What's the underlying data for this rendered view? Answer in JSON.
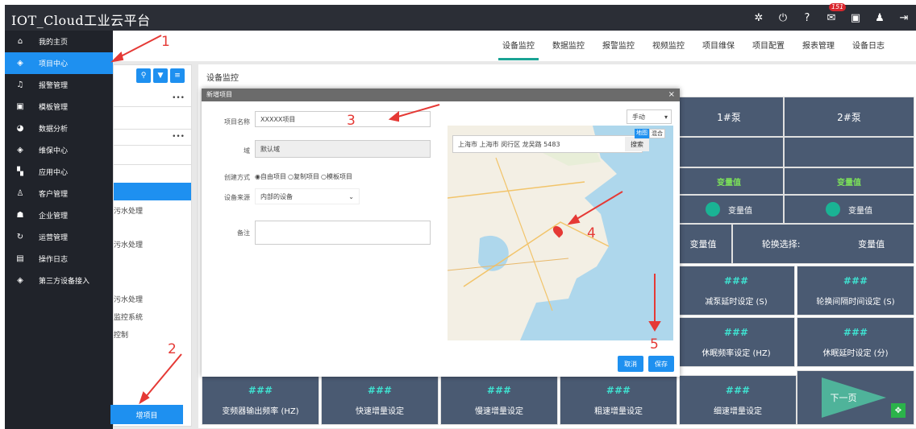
{
  "app": {
    "title": "IOT_Cloud工业云平台",
    "badge": "151"
  },
  "sidebar": {
    "items": [
      {
        "label": "我的主页",
        "icon": "⌂"
      },
      {
        "label": "项目中心",
        "icon": "◈"
      },
      {
        "label": "报警管理",
        "icon": "♫"
      },
      {
        "label": "模板管理",
        "icon": "▣"
      },
      {
        "label": "数据分析",
        "icon": "◕"
      },
      {
        "label": "维保中心",
        "icon": "◈"
      },
      {
        "label": "应用中心",
        "icon": "▚"
      },
      {
        "label": "客户管理",
        "icon": "♙"
      },
      {
        "label": "企业管理",
        "icon": "☗"
      },
      {
        "label": "运营管理",
        "icon": "↻"
      },
      {
        "label": "操作日志",
        "icon": "▤"
      },
      {
        "label": "第三方设备接入",
        "icon": "◈"
      }
    ]
  },
  "nav": {
    "tabs": [
      "设备监控",
      "数据监控",
      "报警监控",
      "视频监控",
      "项目维保",
      "项目配置",
      "报表管理",
      "设备日志"
    ]
  },
  "tree": {
    "dots": "•••",
    "rows": [
      "污水处理",
      "污水处理",
      "污水处理",
      "监控系统",
      "控制"
    ],
    "add_button": "增项目"
  },
  "panel": {
    "title": "设备监控"
  },
  "grid": {
    "pump1": "1#泵",
    "pump2": "2#泵",
    "var": "变量值",
    "switch_label": "轮换选择:",
    "hash": "###",
    "labels": [
      "减泵延时设定 (S)",
      "轮换间隔时间设定 (S)",
      "休眠频率设定 (HZ)",
      "休眠延时设定 (分)"
    ],
    "bottom": [
      "变频器输出频率 (HZ)",
      "快速增量设定",
      "慢速增量设定",
      "粗速增量设定",
      "细速增量设定"
    ],
    "next": "下一页",
    "left_var": "变量值"
  },
  "modal": {
    "title": "新增项目",
    "close": "×",
    "name_label": "项目名称",
    "name_value": "XXXXX项目",
    "domain_label": "域",
    "domain_value": "默认域",
    "create_label": "创建方式",
    "create_options": [
      "自由项目",
      "复制项目",
      "模板项目"
    ],
    "source_label": "设备来源",
    "source_value": "内部的设备",
    "note_label": "备注",
    "map_mode": "手动",
    "map_address": "上海市 上海市 闵行区 龙吴路 5483",
    "map_search": "搜索",
    "map_type_a": "地图",
    "map_type_b": "混合",
    "cancel": "取消",
    "save": "保存"
  },
  "annotations": [
    "1",
    "2",
    "3",
    "4",
    "5"
  ]
}
